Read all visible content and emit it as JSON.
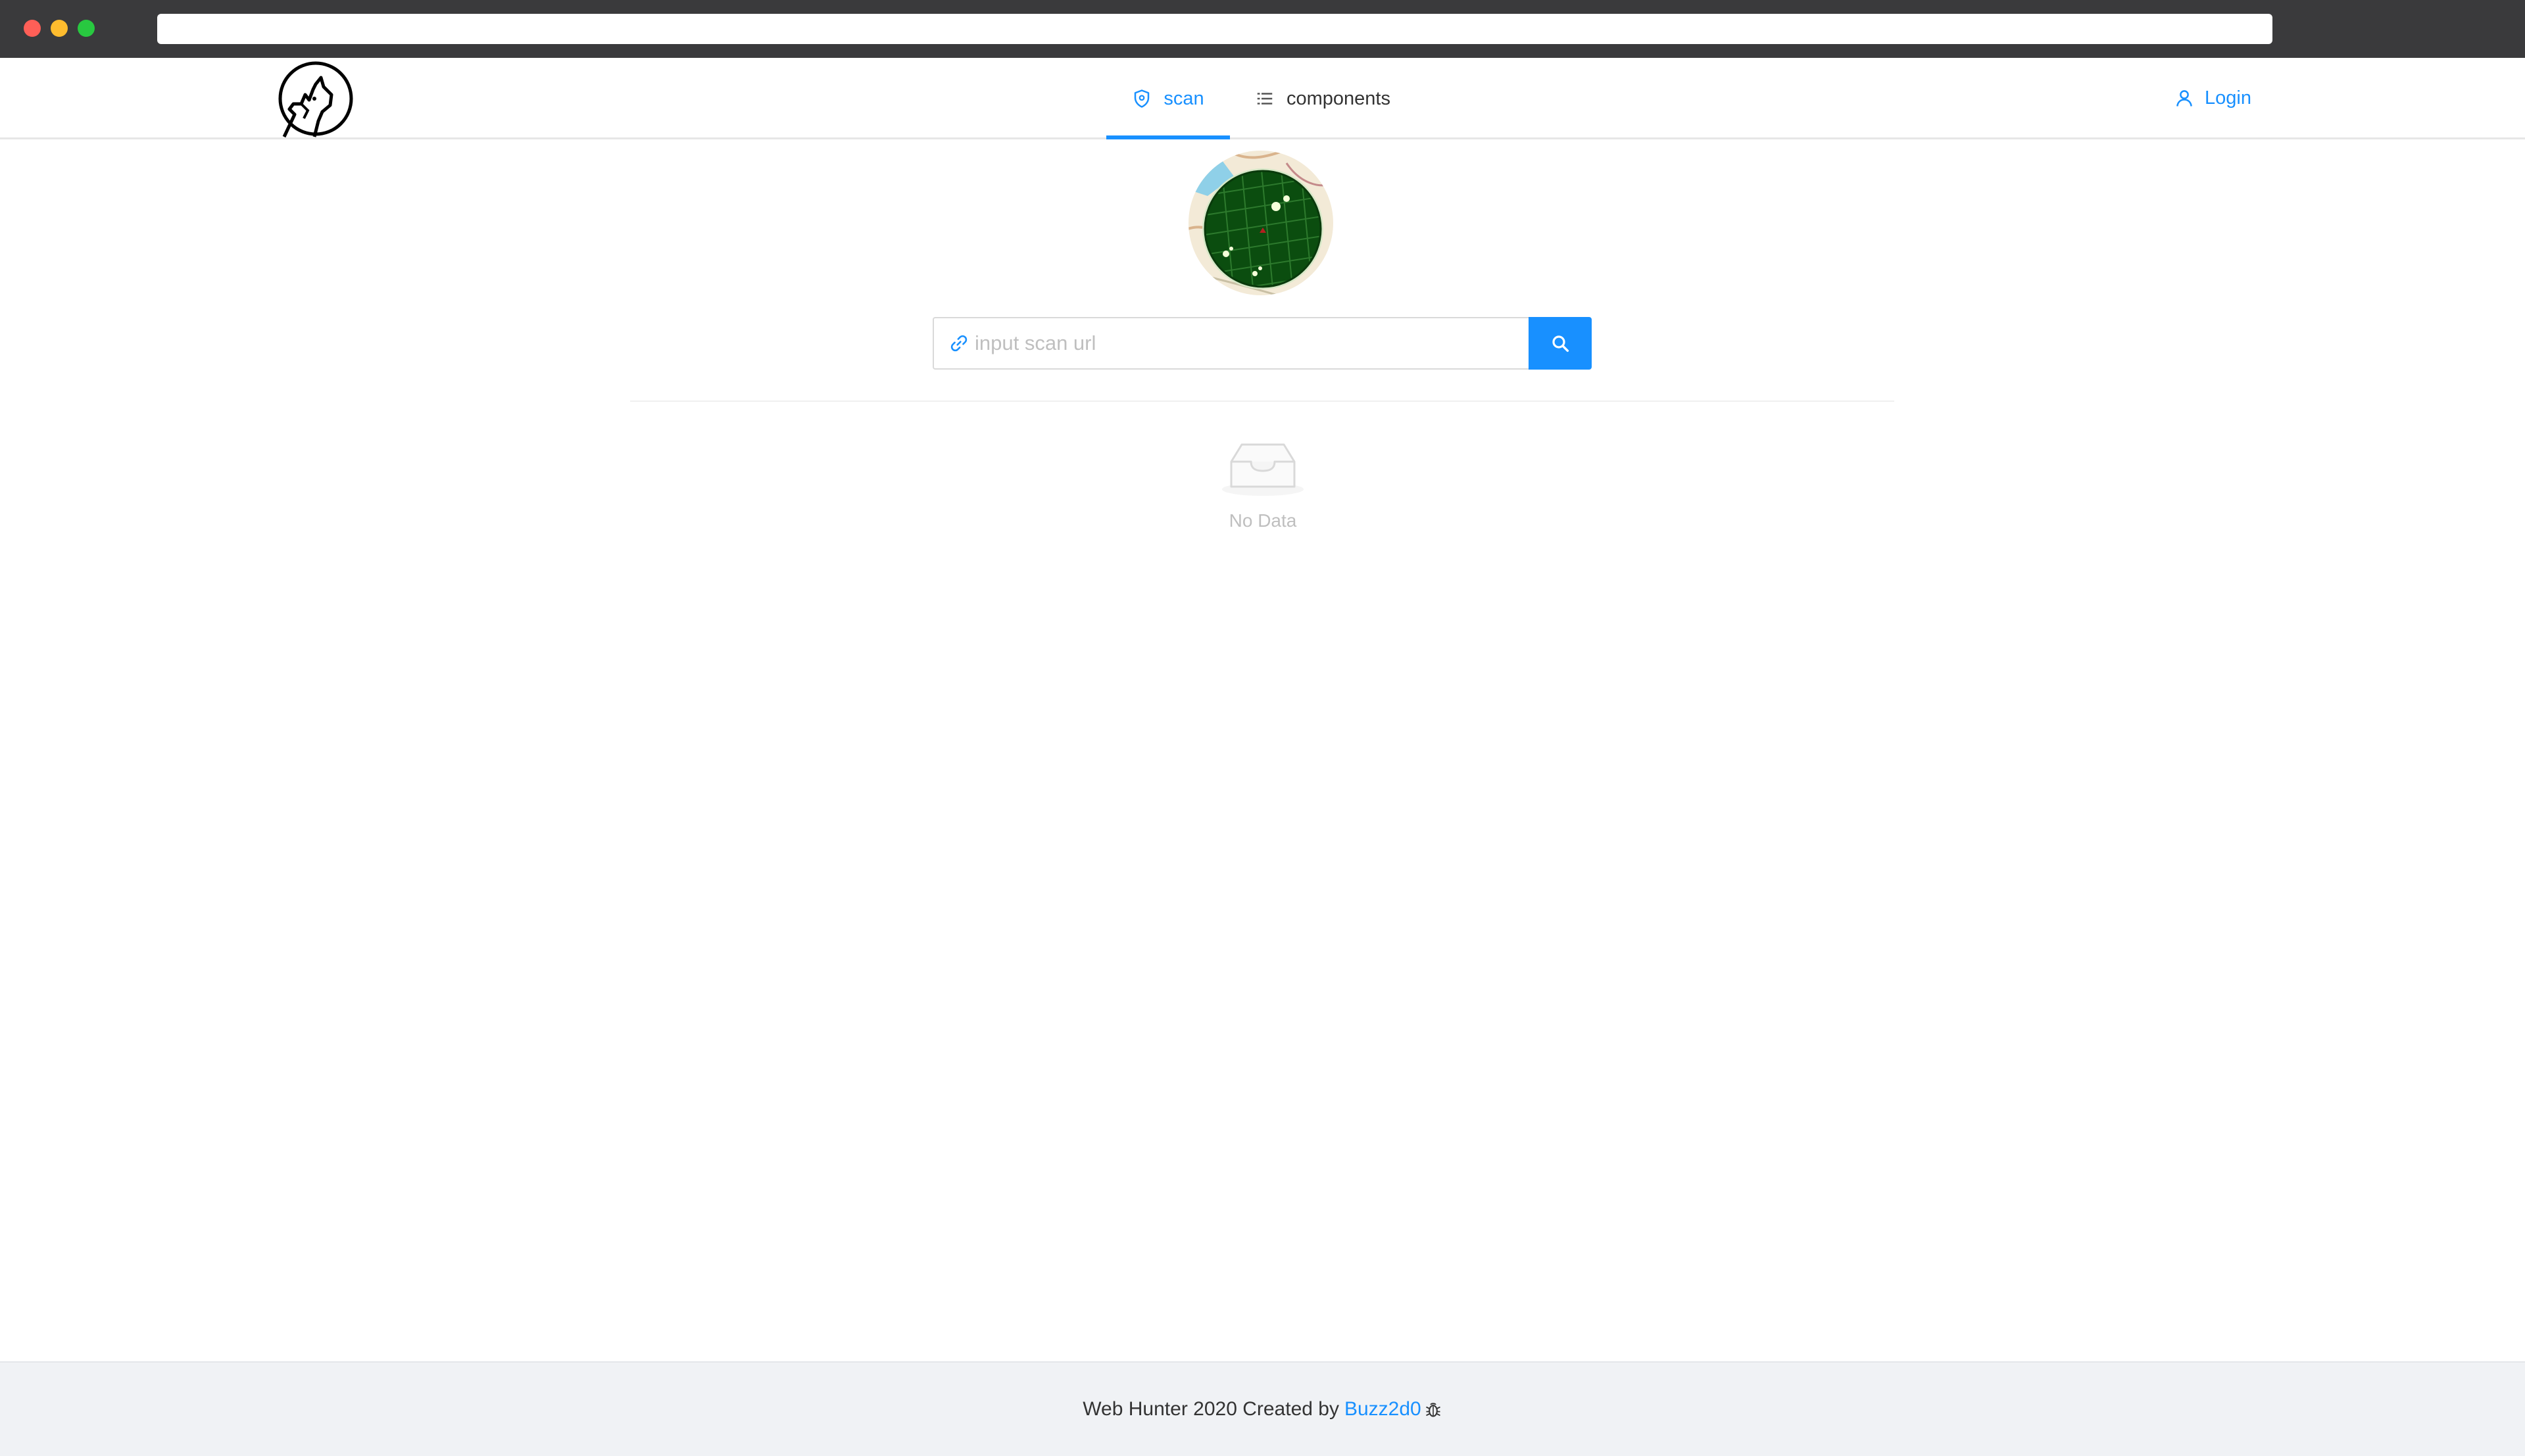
{
  "nav": {
    "tabs": [
      {
        "label": "scan",
        "icon": "shield-icon",
        "active": true
      },
      {
        "label": "components",
        "icon": "list-icon",
        "active": false
      }
    ],
    "login_label": "Login"
  },
  "search": {
    "placeholder": "input scan url",
    "value": ""
  },
  "empty": {
    "text": "No Data"
  },
  "footer": {
    "text": "Web Hunter 2020 Created by",
    "author": "Buzz2d0",
    "icon": "bug-icon"
  },
  "colors": {
    "accent": "#1890ff",
    "footer_bg": "#f0f2f5",
    "radar_green": "#0b4d0f"
  }
}
